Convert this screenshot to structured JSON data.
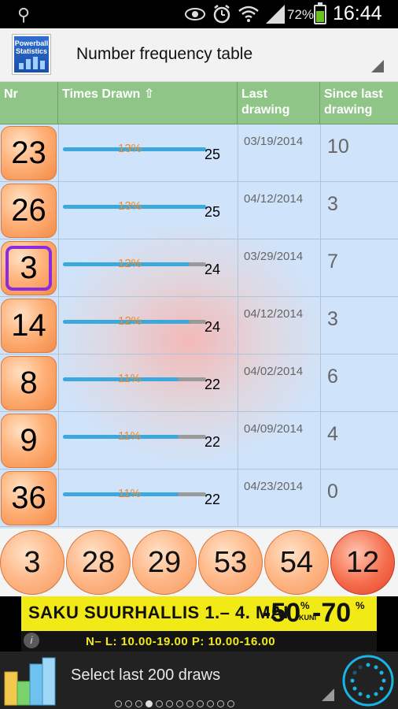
{
  "status": {
    "battery": "72%",
    "time": "16:44"
  },
  "app": {
    "logo_text": "Powerball Statistics",
    "title": "Number frequency table"
  },
  "table": {
    "headers": {
      "nr": "Nr",
      "times_drawn": "Times Drawn ⇧",
      "last_drawing": "Last drawing",
      "since_last": "Since last drawing"
    },
    "max_count": 25,
    "rows": [
      {
        "nr": "23",
        "percent": "13%",
        "count": 25,
        "count_label": "25",
        "last": "03/19/2014",
        "since": "10",
        "selected": false
      },
      {
        "nr": "26",
        "percent": "13%",
        "count": 25,
        "count_label": "25",
        "last": "04/12/2014",
        "since": "3",
        "selected": false
      },
      {
        "nr": "3",
        "percent": "12%",
        "count": 24,
        "count_label": "24",
        "last": "03/29/2014",
        "since": "7",
        "selected": true
      },
      {
        "nr": "14",
        "percent": "12%",
        "count": 24,
        "count_label": "24",
        "last": "04/12/2014",
        "since": "3",
        "selected": false
      },
      {
        "nr": "8",
        "percent": "11%",
        "count": 22,
        "count_label": "22",
        "last": "04/02/2014",
        "since": "6",
        "selected": false
      },
      {
        "nr": "9",
        "percent": "11%",
        "count": 22,
        "count_label": "22",
        "last": "04/09/2014",
        "since": "4",
        "selected": false
      },
      {
        "nr": "36",
        "percent": "11%",
        "count": 22,
        "count_label": "22",
        "last": "04/23/2014",
        "since": "0",
        "selected": false
      }
    ]
  },
  "balls": {
    "white": [
      "3",
      "28",
      "29",
      "53",
      "54"
    ],
    "power": "12"
  },
  "ad": {
    "headline": "SAKU SUURHALLIS  1.– 4. MAI",
    "discount_a": "-50",
    "discount_b": "-70",
    "percent_sign": "%",
    "kuni": "KUNI",
    "hours": "N– L: 10.00-19.00   P: 10.00-16.00",
    "info": "i"
  },
  "bottom": {
    "select_label": "Select last 200 draws",
    "page_count": 12,
    "active_page": 3
  },
  "colors": {
    "header_green": "#8fc587",
    "table_blue": "#cfe4fb",
    "bar_blue": "#3da8dc",
    "percent_orange": "#f08a2a",
    "selection_purple": "#8a2be2",
    "ad_yellow": "#f2ea17"
  }
}
